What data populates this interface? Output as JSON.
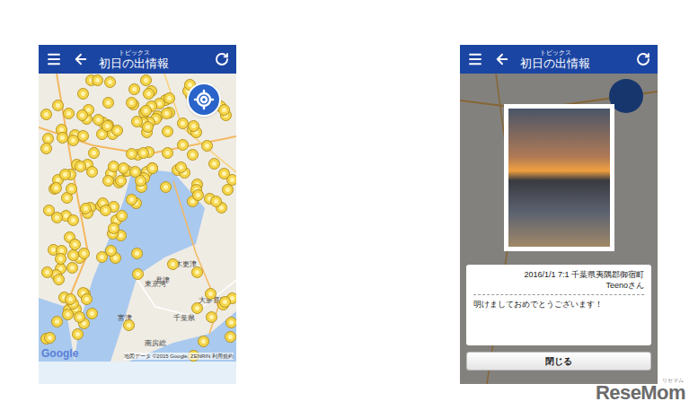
{
  "screens": [
    {
      "header": {
        "menu": "☰",
        "subtitle": "トピックス",
        "title": "初日の出情報"
      },
      "map": {
        "labels": [
          "東京湾",
          "木更津",
          "君津",
          "富津",
          "千葉県",
          "大多喜町",
          "南房総"
        ],
        "logo": "Google",
        "attribution": "地図データ ©2015 Google, ZENRIN",
        "terms": "利用規約"
      },
      "dialog": null
    },
    {
      "header": {
        "menu": "☰",
        "subtitle": "トピックス",
        "title": "初日の出情報"
      },
      "map": null,
      "dialog": {
        "datetime_place": "2016/1/1 7:1 千葉県夷隅郡御宿町",
        "user": "Teenoさん",
        "message": "明けましておめでとうございます！",
        "close_button": "閉じる"
      }
    }
  ],
  "watermark": {
    "logo": "ReseMom",
    "kana": "リセマム"
  }
}
